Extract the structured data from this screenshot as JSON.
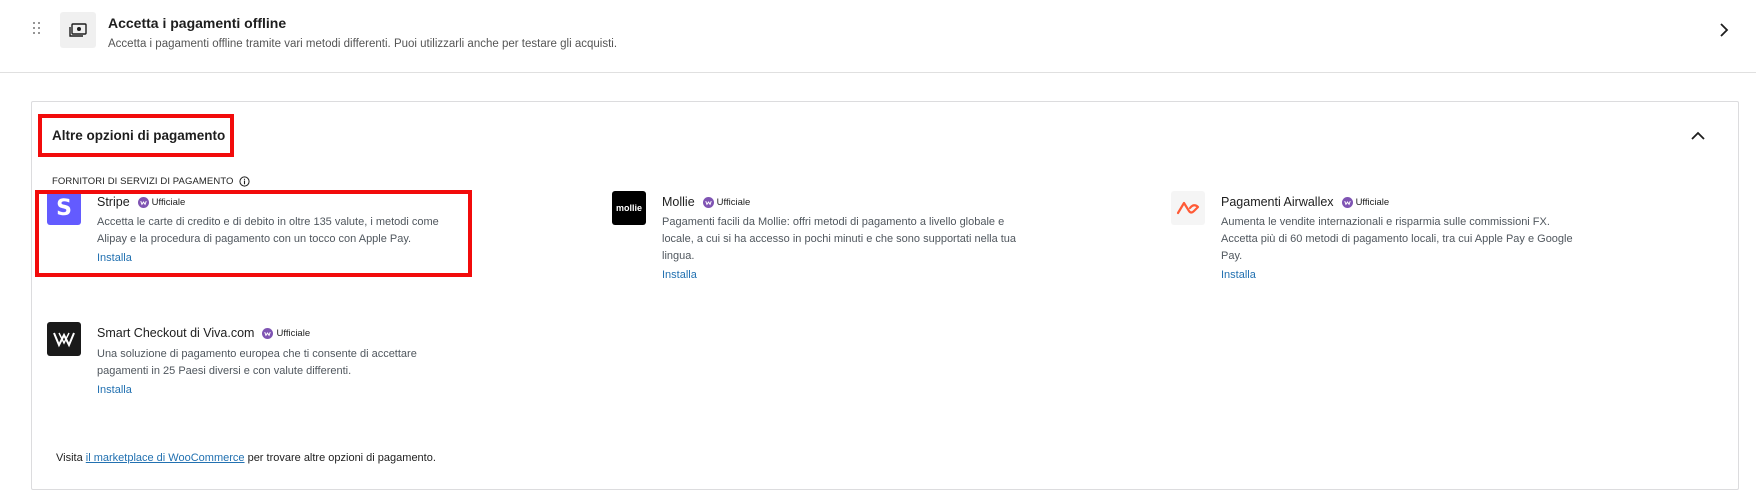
{
  "offline": {
    "icon": "cash-icon",
    "title": "Accetta i pagamenti offline",
    "description": "Accetta i pagamenti offline tramite vari metodi differenti. Puoi utilizzarli anche per testare gli acquisti."
  },
  "section": {
    "title": "Altre opzioni di pagamento",
    "providers_label": "FORNITORI DI SERVIZI DI PAGAMENTO"
  },
  "providers": [
    {
      "name": "Stripe",
      "badge": "Ufficiale",
      "logo_text": "S",
      "desc_lines": [
        "Accetta le carte di credito e di debito in oltre 135 valute, i metodi come",
        "Alipay e la procedura di pagamento con un tocco con Apple Pay."
      ],
      "install": "Installa"
    },
    {
      "name": "Mollie",
      "badge": "Ufficiale",
      "logo_text": "mollie",
      "desc_lines": [
        "Pagamenti facili da Mollie: offri metodi di pagamento a livello globale e",
        "locale, a cui si ha accesso in pochi minuti e che sono supportati nella tua",
        "lingua."
      ],
      "install": "Installa"
    },
    {
      "name": "Pagamenti Airwallex",
      "badge": "Ufficiale",
      "logo_text": "",
      "desc_lines": [
        "Aumenta le vendite internazionali e risparmia sulle commissioni FX.",
        "Accetta più di 60 metodi di pagamento locali, tra cui Apple Pay e Google",
        "Pay."
      ],
      "install": "Installa"
    },
    {
      "name": "Smart Checkout di Viva.com",
      "badge": "Ufficiale",
      "logo_text": "",
      "desc_lines": [
        "Una soluzione di pagamento europea che ti consente di accettare",
        "pagamenti in 25 Paesi diversi e con valute differenti."
      ],
      "install": "Installa"
    }
  ],
  "footer": {
    "prefix": "Visita ",
    "link": "il marketplace di WooCommerce",
    "suffix": " per trovare altre opzioni di pagamento."
  },
  "colors": {
    "accent_link": "#2271b1",
    "stripe": "#635bff",
    "woo_badge": "#7f54b3",
    "airwallex": "#ff5a36",
    "highlight": "#f20b0b"
  }
}
